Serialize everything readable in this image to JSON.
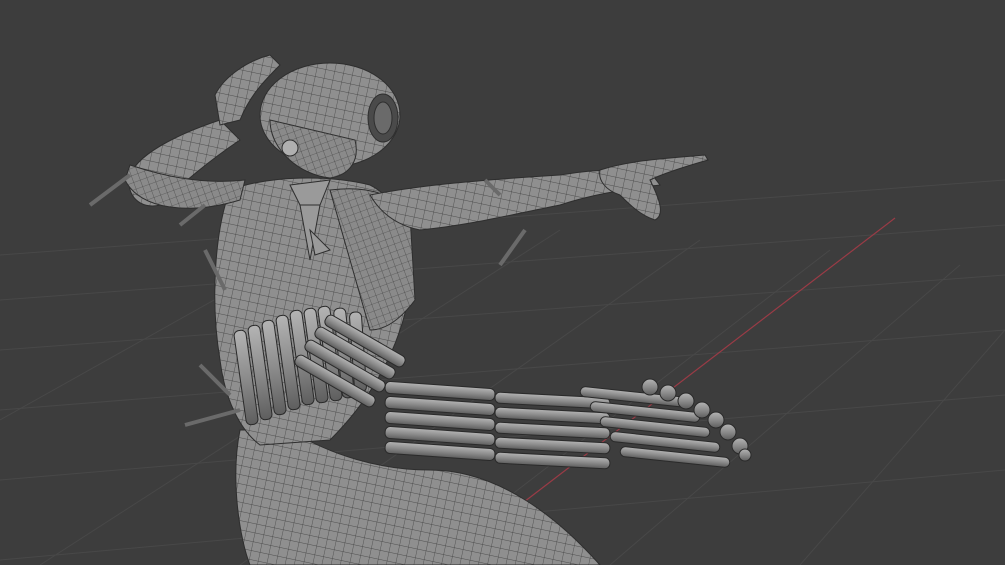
{
  "viewport": {
    "background": "#3d3d3d",
    "grid_color": "#4a4a4a",
    "x_axis_color": "#9a3b46",
    "mesh_fill": "#8d8d8d",
    "mesh_shade": "#6a6a6a",
    "wire_color": "#2f2f2f"
  },
  "model": {
    "display_mode": "wireframe-overlay",
    "subject": "humanoid-figure-mesh"
  }
}
